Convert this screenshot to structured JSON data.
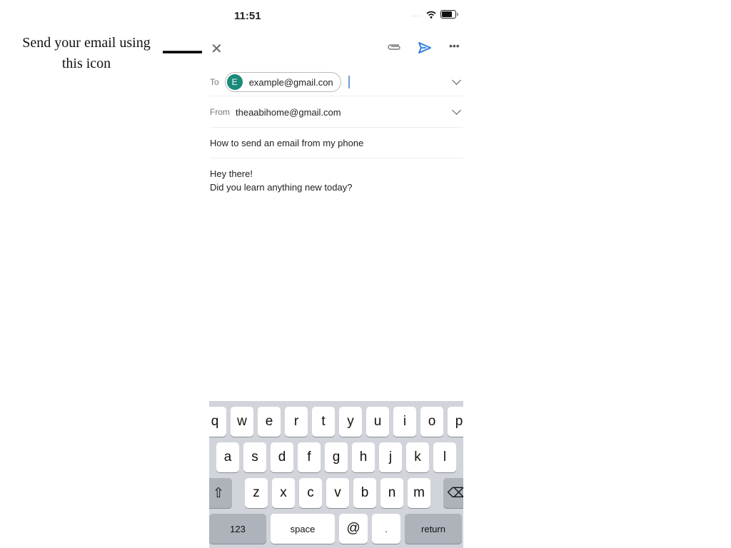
{
  "annotation": {
    "line1": "Send your email using",
    "line2": "this icon"
  },
  "status_bar": {
    "time": "11:51",
    "signal": "....",
    "icons": [
      "wifi-icon",
      "battery-icon"
    ]
  },
  "toolbar": {
    "close_icon": "✕",
    "attach_icon": "paperclip-icon",
    "send_icon": "send-icon",
    "send_color": "#2b7de1",
    "more_icon": "•••"
  },
  "compose": {
    "to_label": "To",
    "to_recipient": "example@gmail.con",
    "to_avatar_initial": "E",
    "avatar_color": "#1a8a7a",
    "from_label": "From",
    "from_value": "theaabihome@gmail.com",
    "subject": "How to send an email from my phone",
    "body_line1": "Hey there!",
    "body_line2": "Did you learn anything new today?"
  },
  "keyboard": {
    "row1": [
      "q",
      "w",
      "e",
      "r",
      "t",
      "y",
      "u",
      "i",
      "o",
      "p"
    ],
    "row2": [
      "a",
      "s",
      "d",
      "f",
      "g",
      "h",
      "j",
      "k",
      "l"
    ],
    "row3": [
      "z",
      "x",
      "c",
      "v",
      "b",
      "n",
      "m"
    ],
    "shift": "⇧",
    "backspace": "⌫",
    "numbers": "123",
    "space": "space",
    "at": "@",
    "period": ".",
    "return": "return"
  }
}
